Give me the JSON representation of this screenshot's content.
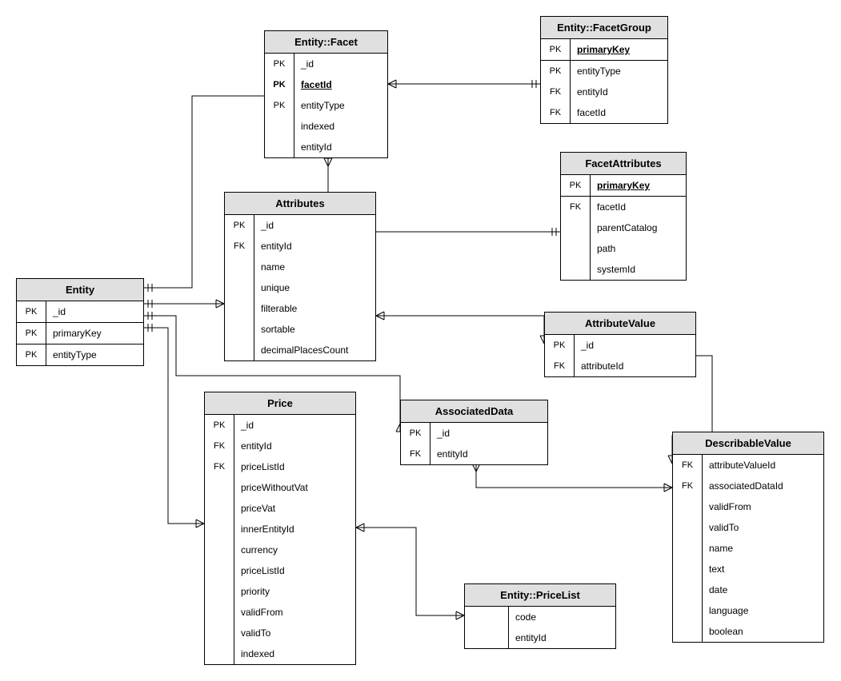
{
  "entities": {
    "entity": {
      "title": "Entity",
      "rows": [
        {
          "key": "PK",
          "name": "_id"
        },
        {
          "key": "PK",
          "name": "primaryKey"
        },
        {
          "key": "PK",
          "name": "entityType"
        }
      ]
    },
    "facet": {
      "title": "Entity::Facet",
      "rows": [
        {
          "key": "PK",
          "name": "_id"
        },
        {
          "key": "PK",
          "name": "facetId",
          "bold": true
        },
        {
          "key": "PK",
          "name": "entityType"
        },
        {
          "key": "",
          "name": "indexed"
        },
        {
          "key": "",
          "name": "entityId"
        }
      ]
    },
    "facetGroup": {
      "title": "Entity::FacetGroup",
      "rows": [
        {
          "key": "PK",
          "name": "primaryKey",
          "bold_pk": true
        },
        {
          "key": "PK",
          "name": "entityType"
        },
        {
          "key": "FK",
          "name": "entityId"
        },
        {
          "key": "FK",
          "name": "facetId"
        }
      ]
    },
    "facetAttributes": {
      "title": "FacetAttributes",
      "rows": [
        {
          "key": "PK",
          "name": "primaryKey",
          "bold_pk": true
        },
        {
          "key": "FK",
          "name": "facetId"
        },
        {
          "key": "",
          "name": "parentCatalog"
        },
        {
          "key": "",
          "name": "path"
        },
        {
          "key": "",
          "name": "systemId"
        }
      ]
    },
    "attributes": {
      "title": "Attributes",
      "rows": [
        {
          "key": "PK",
          "name": "_id"
        },
        {
          "key": "FK",
          "name": "entityId"
        },
        {
          "key": "",
          "name": "name"
        },
        {
          "key": "",
          "name": "unique"
        },
        {
          "key": "",
          "name": "filterable"
        },
        {
          "key": "",
          "name": "sortable"
        },
        {
          "key": "",
          "name": "decimalPlacesCount"
        }
      ]
    },
    "attributeValue": {
      "title": "AttributeValue",
      "rows": [
        {
          "key": "PK",
          "name": "_id"
        },
        {
          "key": "FK",
          "name": "attributeId"
        }
      ]
    },
    "associatedData": {
      "title": "AssociatedData",
      "rows": [
        {
          "key": "PK",
          "name": "_id"
        },
        {
          "key": "FK",
          "name": "entityId"
        }
      ]
    },
    "price": {
      "title": "Price",
      "rows": [
        {
          "key": "PK",
          "name": "_id"
        },
        {
          "key": "FK",
          "name": "entityId"
        },
        {
          "key": "FK",
          "name": "priceListId"
        },
        {
          "key": "",
          "name": "priceWithoutVat"
        },
        {
          "key": "",
          "name": "priceVat"
        },
        {
          "key": "",
          "name": "innerEntityId"
        },
        {
          "key": "",
          "name": "currency"
        },
        {
          "key": "",
          "name": "priceListId"
        },
        {
          "key": "",
          "name": "priority"
        },
        {
          "key": "",
          "name": "validFrom"
        },
        {
          "key": "",
          "name": "validTo"
        },
        {
          "key": "",
          "name": "indexed"
        }
      ]
    },
    "priceList": {
      "title": "Entity::PriceList",
      "rows": [
        {
          "key": "",
          "name": "code"
        },
        {
          "key": "",
          "name": "entityId"
        }
      ]
    },
    "describableValue": {
      "title": "DescribableValue",
      "rows": [
        {
          "key": "FK",
          "name": "attributeValueId"
        },
        {
          "key": "FK",
          "name": "associatedDataId"
        },
        {
          "key": "",
          "name": "validFrom"
        },
        {
          "key": "",
          "name": "validTo"
        },
        {
          "key": "",
          "name": "name"
        },
        {
          "key": "",
          "name": "text"
        },
        {
          "key": "",
          "name": "date"
        },
        {
          "key": "",
          "name": "language"
        },
        {
          "key": "",
          "name": "boolean"
        }
      ]
    }
  }
}
